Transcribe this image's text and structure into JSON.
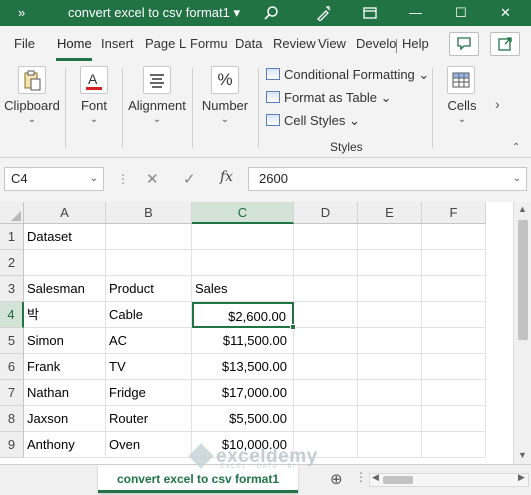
{
  "titlebar": {
    "more": "»",
    "title": "convert excel to csv format1",
    "title_caret": "▾",
    "search_icon": "search-icon",
    "min": "—",
    "max": "☐",
    "close": "✕"
  },
  "ribbon_tabs": [
    "File",
    "Home",
    "Insert",
    "Page L",
    "Formu",
    "Data",
    "Review",
    "View",
    "Develo",
    "Help"
  ],
  "active_tab": "Home",
  "ribbon": {
    "clipboard": {
      "label": "Clipboard",
      "caret": "⌄"
    },
    "font": {
      "label": "Font",
      "caret": "⌄"
    },
    "alignment": {
      "label": "Alignment",
      "caret": "⌄"
    },
    "number": {
      "label": "Number",
      "caret": "⌄",
      "icon_text": "%"
    },
    "styles": {
      "items": [
        "Conditional Formatting",
        "Format as Table",
        "Cell Styles"
      ],
      "group_label": "Styles"
    },
    "cells": {
      "label": "Cells",
      "caret": "⌄"
    },
    "collapse": "⌃",
    "scroll_right": "›"
  },
  "formula_bar": {
    "name_box": "C4",
    "name_caret": "⌄",
    "dots": "⋮",
    "cancel": "✕",
    "enter": "✓",
    "fx": "fx",
    "value": "2600",
    "value_caret": "⌄"
  },
  "grid": {
    "columns": [
      "A",
      "B",
      "C",
      "D",
      "E",
      "F"
    ],
    "selected_column": "C",
    "rows": [
      {
        "num": "1",
        "cells": [
          "Dataset",
          "",
          "",
          "",
          "",
          ""
        ]
      },
      {
        "num": "2",
        "cells": [
          "",
          "",
          "",
          "",
          "",
          ""
        ]
      },
      {
        "num": "3",
        "cells": [
          "Salesman",
          "Product",
          "Sales",
          "",
          "",
          ""
        ]
      },
      {
        "num": "4",
        "cells": [
          "박",
          "Cable",
          "$2,600.00",
          "",
          "",
          ""
        ]
      },
      {
        "num": "5",
        "cells": [
          "Simon",
          "AC",
          "$11,500.00",
          "",
          "",
          ""
        ]
      },
      {
        "num": "6",
        "cells": [
          "Frank",
          "TV",
          "$13,500.00",
          "",
          "",
          ""
        ]
      },
      {
        "num": "7",
        "cells": [
          "Nathan",
          "Fridge",
          "$17,000.00",
          "",
          "",
          ""
        ]
      },
      {
        "num": "8",
        "cells": [
          "Jaxson",
          "Router",
          "$5,500.00",
          "",
          "",
          ""
        ]
      },
      {
        "num": "9",
        "cells": [
          "Anthony",
          "Oven",
          "$10,000.00",
          "",
          "",
          ""
        ]
      }
    ],
    "selected_row": "4",
    "active_cell": "C4"
  },
  "sheetbar": {
    "sheet_name": "convert excel to csv format1",
    "add": "⊕",
    "more": "⋮"
  },
  "watermark": {
    "text": "exceldemy",
    "tagline": "EXCEL · DATA · BI"
  },
  "colors": {
    "accent": "#217346",
    "selection_header": "#d3e3d6"
  }
}
